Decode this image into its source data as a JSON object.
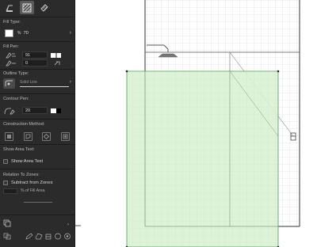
{
  "panel": {
    "fill_type": {
      "title": "Fill Type:",
      "percent_symbol": "%",
      "value": "70"
    },
    "fill_pen": {
      "title": "Fill Pen:",
      "pen_1": "91",
      "pen_2": "0"
    },
    "outline_type": {
      "title": "Outline Type:",
      "line_name": "Solid Line"
    },
    "contour_pen": {
      "title": "Contour Pen:",
      "value": "20"
    },
    "construction_method": {
      "title": "Construction Method:"
    },
    "show_area_text": {
      "title": "Show Area Text:",
      "checkbox_label": "Show Area Text"
    },
    "relation_to_zones": {
      "title": "Relation To Zones:",
      "subtract_label": "Subtract from Zones",
      "fill_area_label": "% of Fill Area"
    },
    "colors": {
      "panel_bg": "#2b2b2b",
      "fill_green": "#d5f0d0",
      "fill_outline": "#4b9a4b"
    }
  },
  "icons": [
    "fill-type-tool-icon",
    "fill-area-tool-icon",
    "fill-eyedropper-icon",
    "chevron-right-icon",
    "pen-icon",
    "color-swatch-icon",
    "link-icon",
    "outline-type-icon",
    "contour-pen-icon",
    "construction-rect-icon",
    "construction-polygon-icon",
    "construction-rotated-icon",
    "construction-custom-icon",
    "shower-fixture-icon",
    "bottom-layer-icon"
  ]
}
